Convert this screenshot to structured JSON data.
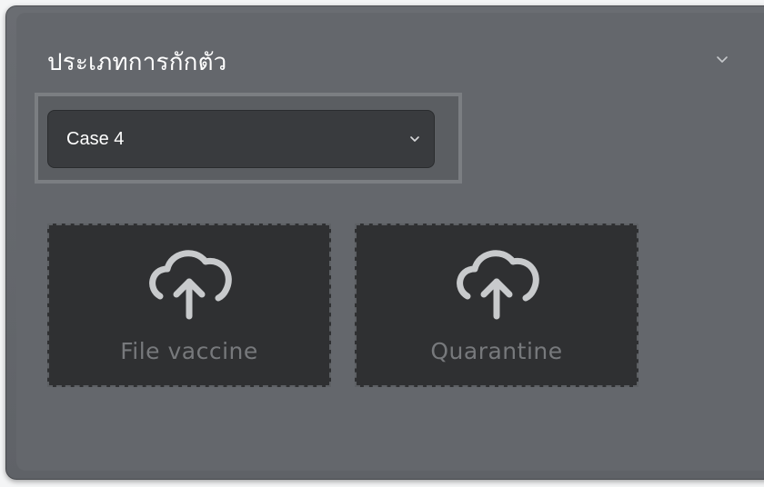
{
  "panel": {
    "title": "ประเภทการกักตัว",
    "collapse_icon": "chevron-down-icon"
  },
  "select": {
    "value": "Case 4",
    "icon": "chevron-down-icon"
  },
  "uploads": [
    {
      "label": "File vaccine",
      "icon": "cloud-upload-icon"
    },
    {
      "label": "Quarantine",
      "icon": "cloud-upload-icon"
    }
  ],
  "colors": {
    "panel_bg": "#64676c",
    "select_bg": "#393b3e",
    "tile_bg": "#2f3032",
    "tile_label": "#77797c",
    "icon": "#c8cacc"
  }
}
